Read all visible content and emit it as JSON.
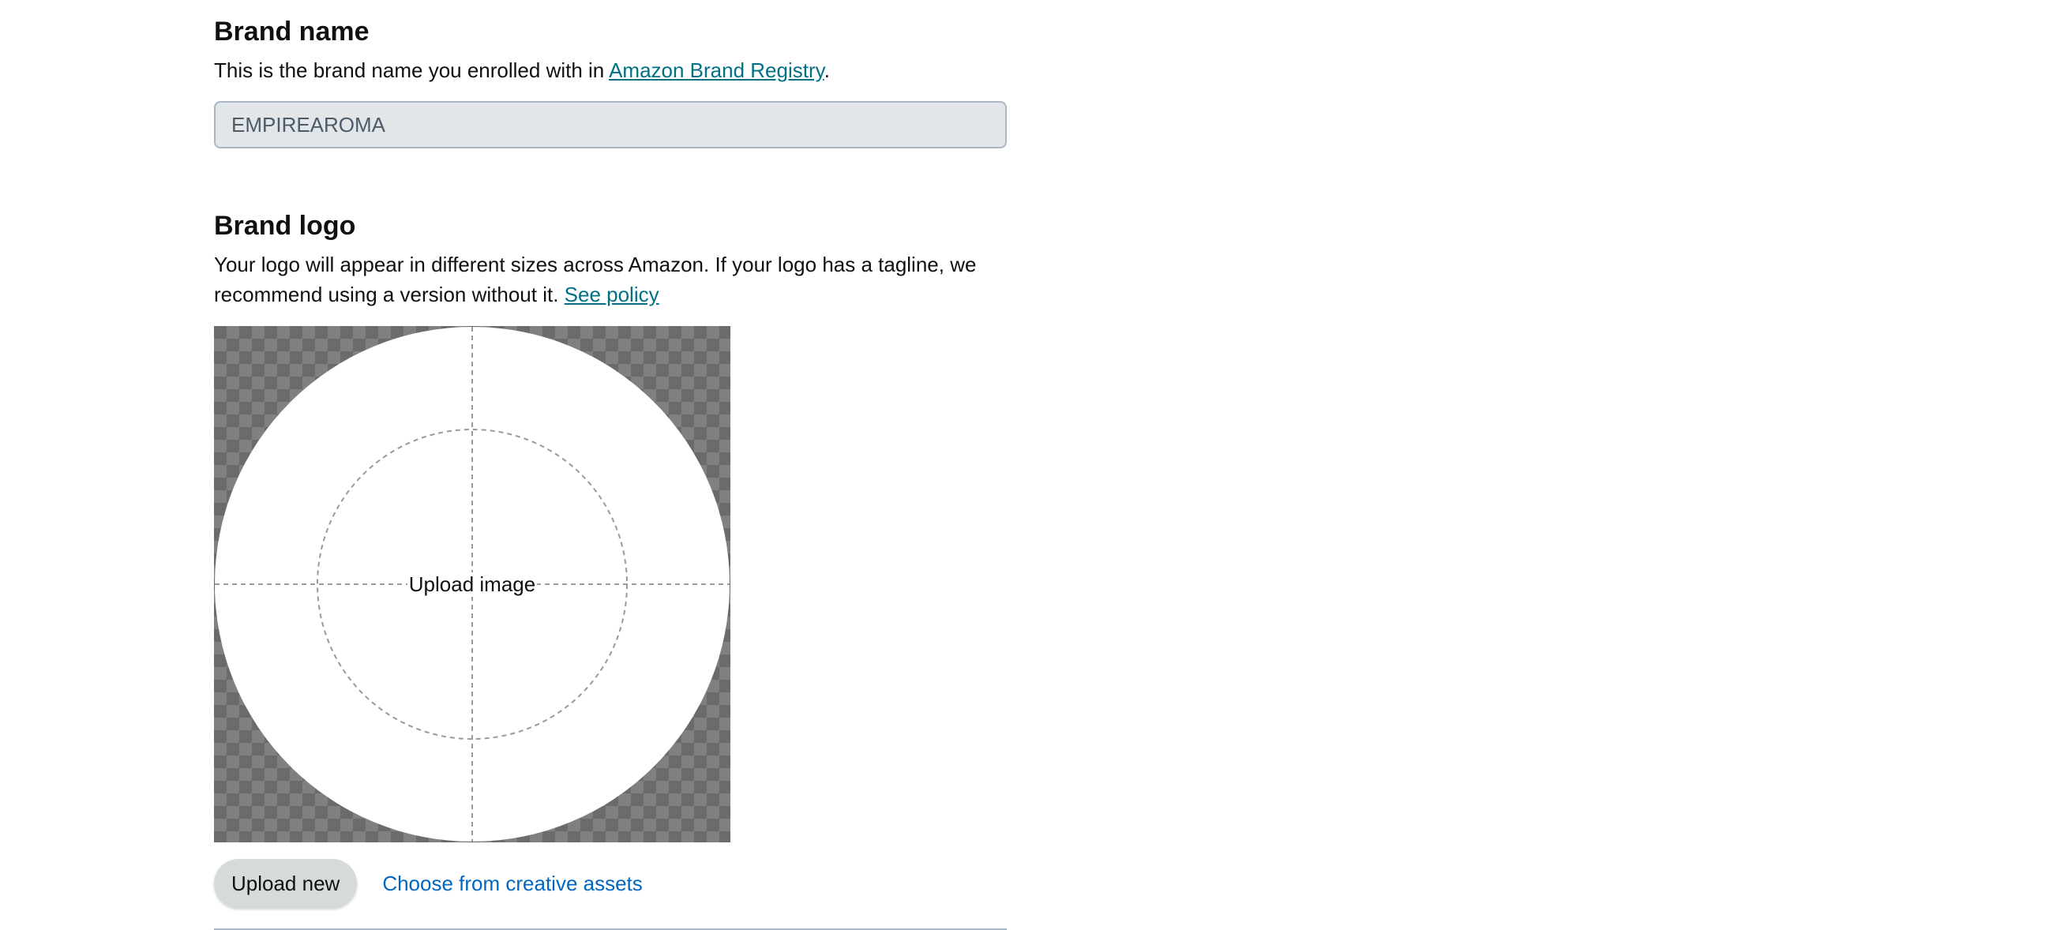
{
  "brand_name": {
    "heading": "Brand name",
    "description_prefix": "This is the brand name you enrolled with in ",
    "registry_link": "Amazon Brand Registry",
    "description_suffix": ".",
    "value": "EMPIREAROMA"
  },
  "brand_logo": {
    "heading": "Brand logo",
    "description": "Your logo will appear in different sizes across Amazon. If your logo has a tagline, we recommend using a version without it. ",
    "policy_link": "See policy",
    "upload_image_label": "Upload image",
    "upload_new_label": "Upload new",
    "choose_assets_label": "Choose from creative assets"
  },
  "colors": {
    "link": "#007185",
    "action_link": "#0066c0",
    "input_bg": "#e3e6e9",
    "button_bg": "#d5dbdb"
  }
}
